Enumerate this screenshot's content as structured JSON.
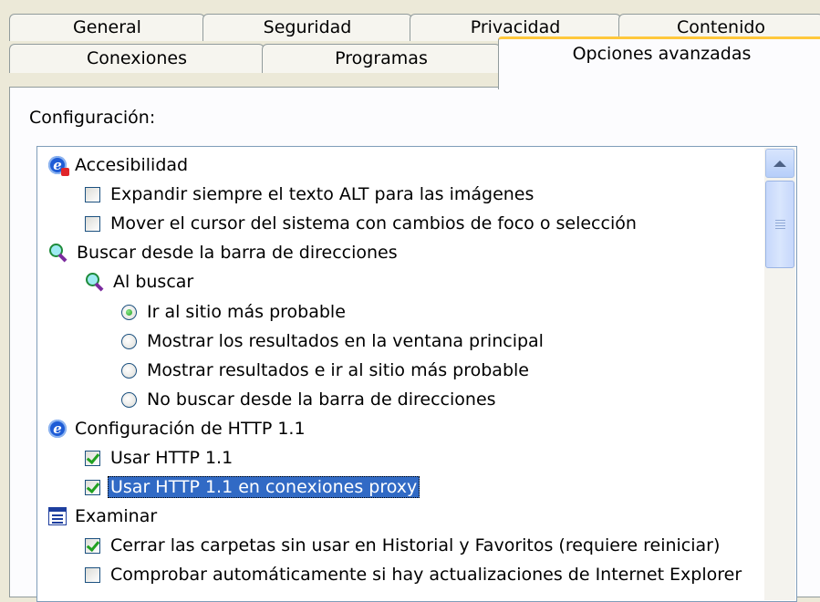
{
  "tabs_row1": [
    "General",
    "Seguridad",
    "Privacidad",
    "Contenido"
  ],
  "tabs_row2": [
    "Conexiones",
    "Programas"
  ],
  "active_tab": "Opciones avanzadas",
  "config_label": "Configuración:",
  "tree": {
    "accessibility": {
      "label": "Accesibilidad",
      "items": [
        {
          "label": "Expandir siempre el texto ALT para las imágenes",
          "checked": false
        },
        {
          "label": "Mover el cursor del sistema con cambios de foco o selección",
          "checked": false
        }
      ]
    },
    "search": {
      "label": "Buscar desde la barra de direcciones",
      "sub_label": "Al buscar",
      "options": [
        {
          "label": "Ir al sitio más probable",
          "selected": true
        },
        {
          "label": "Mostrar los resultados en la ventana principal",
          "selected": false
        },
        {
          "label": "Mostrar resultados e ir al sitio más probable",
          "selected": false
        },
        {
          "label": "No buscar desde la barra de direcciones",
          "selected": false
        }
      ]
    },
    "http": {
      "label": "Configuración de HTTP 1.1",
      "items": [
        {
          "label": "Usar HTTP 1.1",
          "checked": true
        },
        {
          "label": "Usar HTTP 1.1 en conexiones proxy",
          "checked": true
        }
      ]
    },
    "browse": {
      "label": "Examinar",
      "items": [
        {
          "label": "Cerrar las carpetas sin usar en Historial y Favoritos (requiere reiniciar)",
          "checked": true
        },
        {
          "label": "Comprobar automáticamente si hay actualizaciones de Internet Explorer",
          "checked": false
        }
      ]
    }
  },
  "colors": {
    "window_bg": "#ECE9D8",
    "selection": "#316AC5",
    "active_tab_accent": "#FFC83C",
    "check_green": "#21A121"
  },
  "icons": [
    "ie-settings-icon",
    "magnifier-icon",
    "ie-icon",
    "document-list-icon"
  ]
}
